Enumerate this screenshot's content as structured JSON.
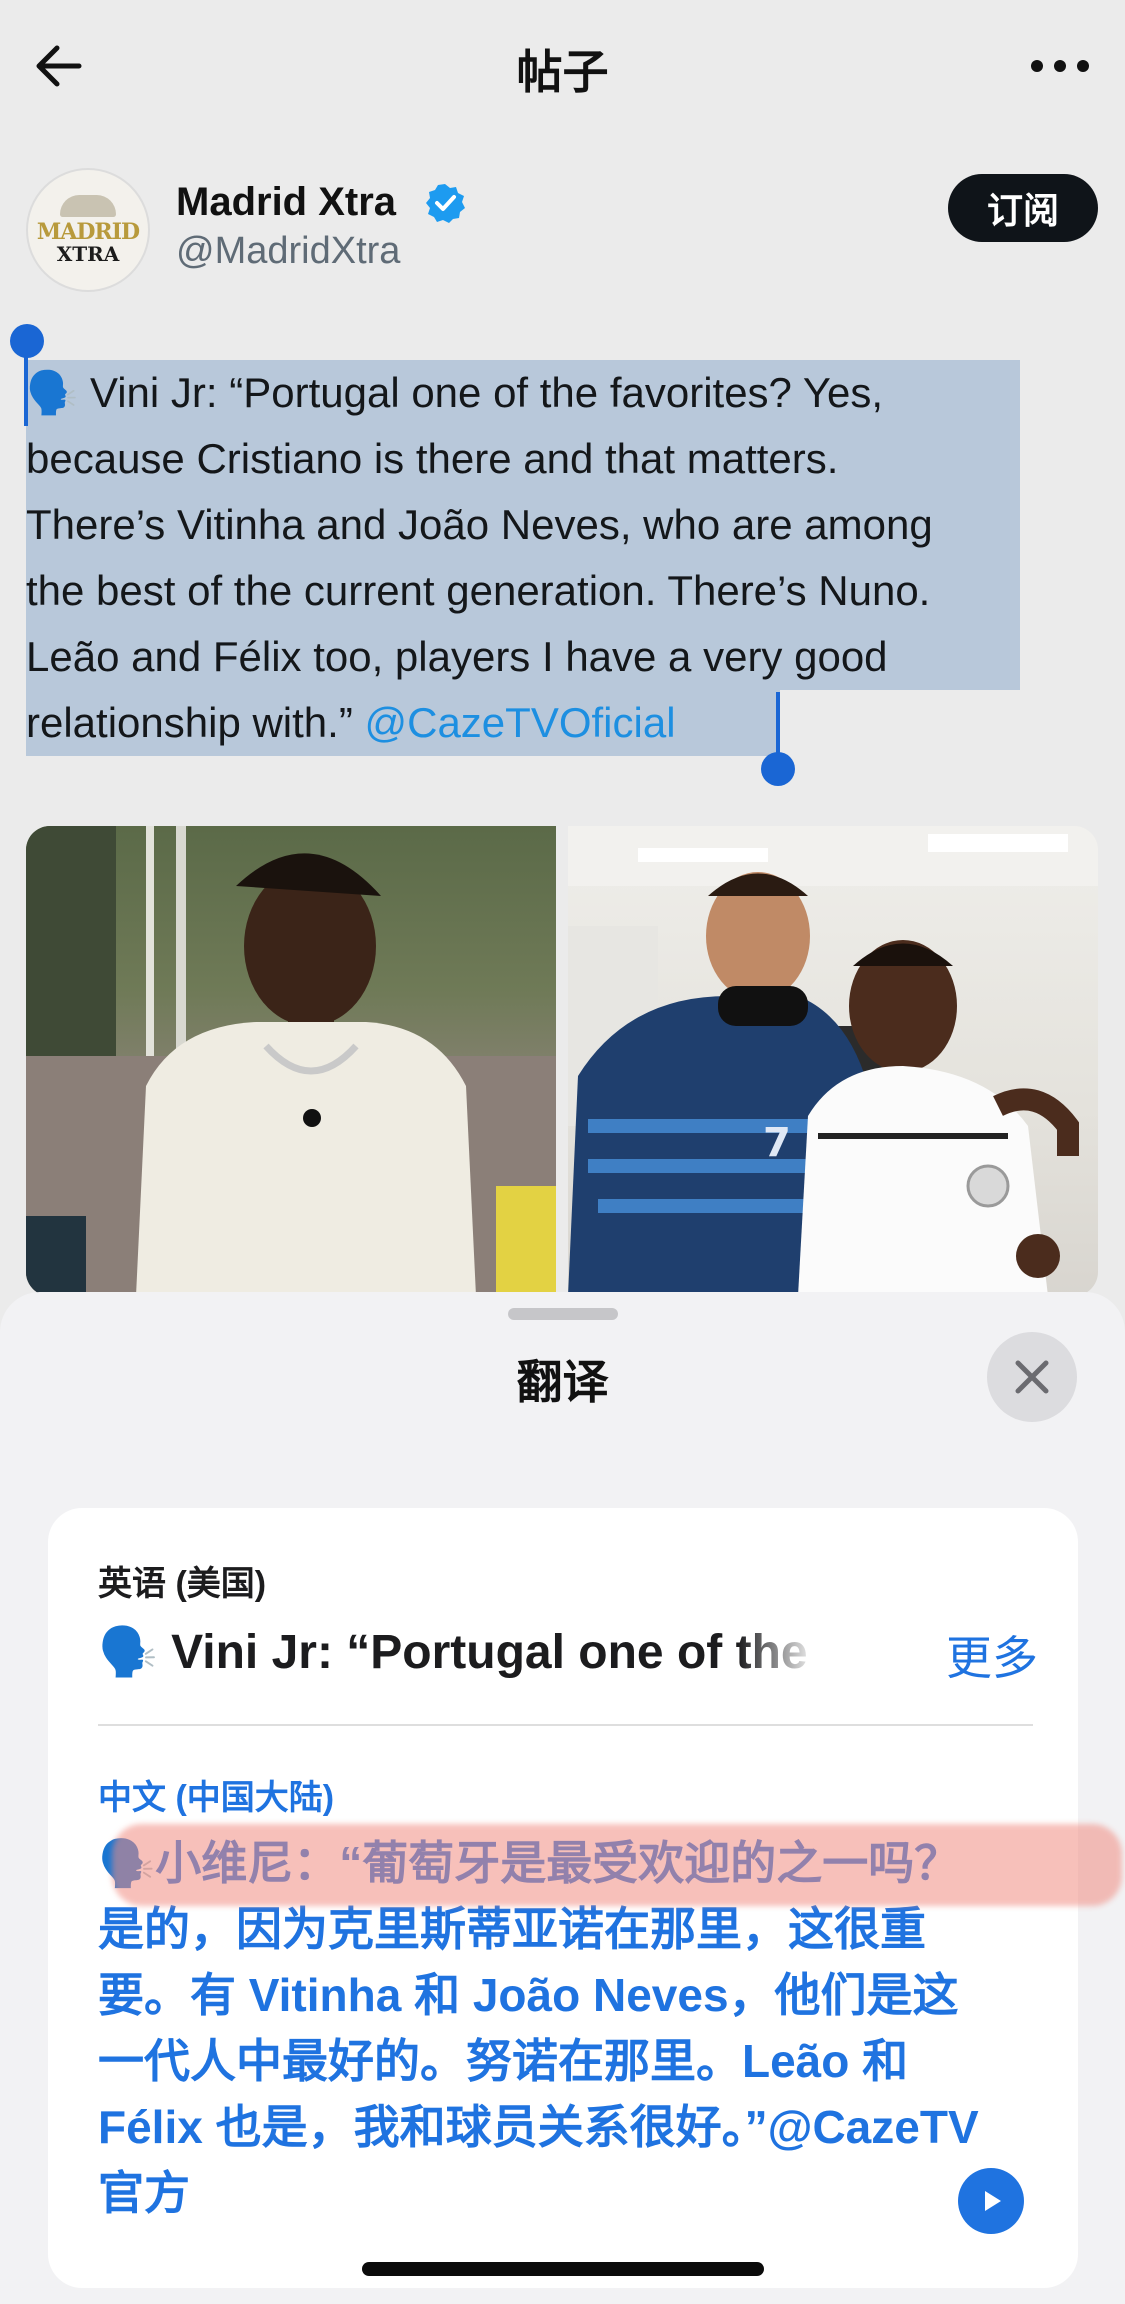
{
  "nav": {
    "title": "帖子",
    "back_icon": "arrow-left-icon",
    "more_icon": "more-horizontal-icon"
  },
  "author": {
    "name": "Madrid Xtra",
    "handle": "@MadridXtra",
    "avatar_text_line1": "MADRID",
    "avatar_text_line2": "XTRA",
    "verified_icon": "verified-badge-icon",
    "subscribe_label": "订阅"
  },
  "post": {
    "emoji": "🗣️",
    "lines": [
      "Vini Jr: “Portugal one of the favorites? Yes,",
      "because Cristiano is there and that matters.",
      "There’s Vitinha and João Neves, who are among",
      "the best of the current generation. There’s Nuno.",
      "Leão and Félix too, players I have a very good",
      "relationship with.”"
    ],
    "mention": "@CazeTVOficial"
  },
  "translate": {
    "title": "翻译",
    "close_icon": "close-icon",
    "source_lang": "英语 (美国)",
    "source_text": "🗣️ Vini Jr: “Portugal one of the favorites? Yes, because Cristiano is there",
    "more_label": "更多",
    "target_lang": "中文 (中国大陆)",
    "target_text": "🗣️小维尼：“葡萄牙是最受欢迎的之一吗？是的，因为克里斯蒂亚诺在那里，这很重要。有 Vitinha 和 João Neves，他们是这一代人中最好的。努诺在那里。Leão 和 Félix 也是，我和球员关系很好。”@CazeTV 官方",
    "play_icon": "play-icon"
  },
  "colors": {
    "accent": "#1f73e0",
    "selection": "#b8c8da",
    "highlight": "#f08c82"
  }
}
